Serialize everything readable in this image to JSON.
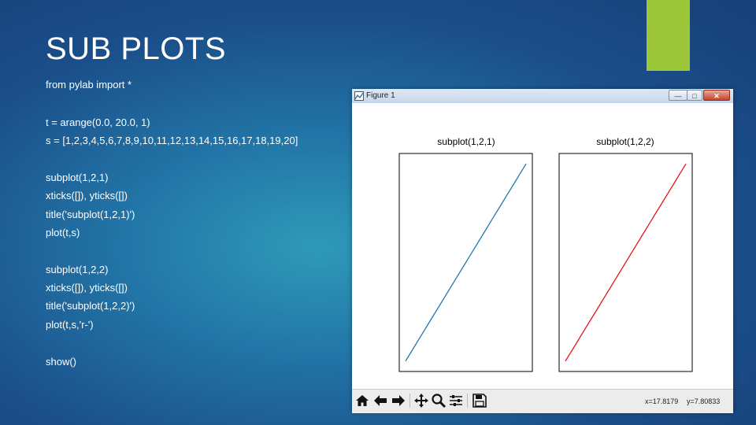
{
  "slide": {
    "title": "SUB PLOTS",
    "code": [
      "from pylab import *",
      "t = arange(0.0, 20.0, 1)",
      "s = [1,2,3,4,5,6,7,8,9,10,11,12,13,14,15,16,17,18,19,20]",
      "subplot(1,2,1)",
      "xticks([]), yticks([])",
      "title('subplot(1,2,1)')",
      "plot(t,s)",
      "subplot(1,2,2)",
      "xticks([]), yticks([])",
      "title('subplot(1,2,2)')",
      "plot(t,s,'r-')",
      "show()"
    ]
  },
  "window": {
    "title": "Figure 1",
    "minimize": "—",
    "maximize": "□",
    "close": "✕"
  },
  "toolbar": {
    "icons": [
      "home-icon",
      "back-arrow-icon",
      "forward-arrow-icon",
      "pan-icon",
      "zoom-icon",
      "subplots-icon",
      "save-icon"
    ],
    "x_readout": "x=17.8179",
    "y_readout": "y=7.80833"
  },
  "colors": {
    "accent": "#9bc739",
    "series1": "#1f77b4",
    "series2": "#e8141b"
  },
  "chart_data": [
    {
      "type": "line",
      "title": "subplot(1,2,1)",
      "xticks": [],
      "yticks": [],
      "xlim": [
        -1,
        20
      ],
      "ylim": [
        0,
        21
      ],
      "series": [
        {
          "x": [
            0,
            1,
            2,
            3,
            4,
            5,
            6,
            7,
            8,
            9,
            10,
            11,
            12,
            13,
            14,
            15,
            16,
            17,
            18,
            19
          ],
          "values": [
            1,
            2,
            3,
            4,
            5,
            6,
            7,
            8,
            9,
            10,
            11,
            12,
            13,
            14,
            15,
            16,
            17,
            18,
            19,
            20
          ],
          "color": "#1f77b4"
        }
      ]
    },
    {
      "type": "line",
      "title": "subplot(1,2,2)",
      "xticks": [],
      "yticks": [],
      "xlim": [
        -1,
        20
      ],
      "ylim": [
        0,
        21
      ],
      "series": [
        {
          "x": [
            0,
            1,
            2,
            3,
            4,
            5,
            6,
            7,
            8,
            9,
            10,
            11,
            12,
            13,
            14,
            15,
            16,
            17,
            18,
            19
          ],
          "values": [
            1,
            2,
            3,
            4,
            5,
            6,
            7,
            8,
            9,
            10,
            11,
            12,
            13,
            14,
            15,
            16,
            17,
            18,
            19,
            20
          ],
          "color": "#e8141b"
        }
      ]
    }
  ]
}
